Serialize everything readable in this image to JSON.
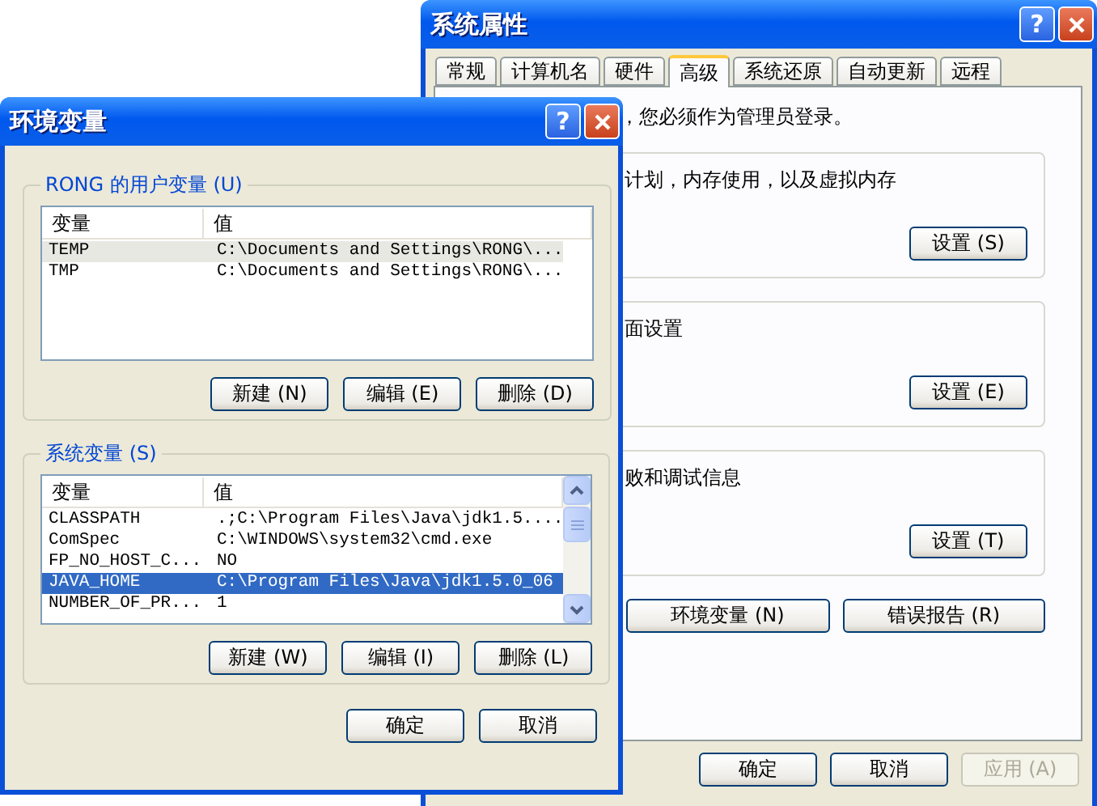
{
  "system_properties": {
    "title": "系统属性",
    "help_button": "?",
    "tabs": [
      {
        "label": "常规",
        "selected": false
      },
      {
        "label": "计算机名",
        "selected": false
      },
      {
        "label": "硬件",
        "selected": false
      },
      {
        "label": "高级",
        "selected": true
      },
      {
        "label": "系统还原",
        "selected": false
      },
      {
        "label": "自动更新",
        "selected": false
      },
      {
        "label": "远程",
        "selected": false
      }
    ],
    "notice": "，您必须作为管理员登录。",
    "groups": [
      {
        "text": "计划，内存使用，以及虚拟内存",
        "button": "设置 (S)"
      },
      {
        "text": "面设置",
        "button": "设置 (E)"
      },
      {
        "text": "败和调试信息",
        "button": "设置 (T)"
      }
    ],
    "buttons": [
      "环境变量 (N)",
      "错误报告 (R)"
    ],
    "footer_buttons": [
      {
        "label": "确定",
        "disabled": false
      },
      {
        "label": "取消",
        "disabled": false
      },
      {
        "label": "应用 (A)",
        "disabled": true
      }
    ]
  },
  "environment_variables": {
    "title": "环境变量",
    "help_button": "?",
    "user_variables": {
      "label": "RONG 的用户变量 (U)",
      "columns": [
        "变量",
        "值"
      ],
      "rows": [
        {
          "name": "TEMP",
          "value": "C:\\Documents and Settings\\RONG\\...",
          "selected": true
        },
        {
          "name": "TMP",
          "value": "C:\\Documents and Settings\\RONG\\...",
          "selected": false
        }
      ],
      "buttons": [
        "新建 (N)",
        "编辑 (E)",
        "删除 (D)"
      ]
    },
    "system_variables": {
      "label": "系统变量 (S)",
      "columns": [
        "变量",
        "值"
      ],
      "rows": [
        {
          "name": "CLASSPATH",
          "value": ".;C:\\Program Files\\Java\\jdk1.5....",
          "selected": false
        },
        {
          "name": "ComSpec",
          "value": "C:\\WINDOWS\\system32\\cmd.exe",
          "selected": false
        },
        {
          "name": "FP_NO_HOST_C...",
          "value": "NO",
          "selected": false
        },
        {
          "name": "JAVA_HOME",
          "value": "C:\\Program Files\\Java\\jdk1.5.0_06",
          "selected": true
        },
        {
          "name": "NUMBER_OF_PR...",
          "value": "1",
          "selected": false
        }
      ],
      "buttons": [
        "新建 (W)",
        "编辑 (I)",
        "删除 (L)"
      ]
    },
    "buttons": [
      "确定",
      "取消"
    ]
  }
}
